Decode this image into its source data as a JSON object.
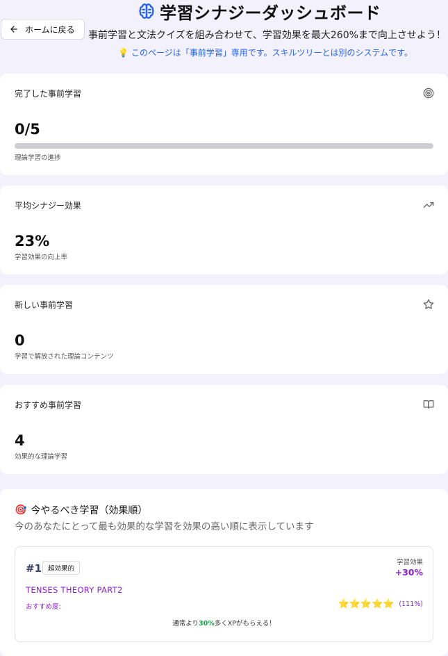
{
  "header": {
    "back_label": "ホームに戻る",
    "title": "学習シナジーダッシュボード",
    "subtitle": "事前学習と文法クイズを組み合わせて、学習効果を最大260%まで向上させよう！",
    "tip_icon": "💡",
    "tip": "このページは「事前学習」専用です。スキルツリーとは別のシステムです。"
  },
  "stats": [
    {
      "title": "完了した事前学習",
      "value": "0/5",
      "caption": "理論学習の進捗",
      "icon": "target-icon",
      "progress": 0
    },
    {
      "title": "平均シナジー効果",
      "value": "23%",
      "caption": "学習効果の向上率",
      "icon": "trending-up-icon"
    },
    {
      "title": "新しい事前学習",
      "value": "0",
      "caption": "学習で解放された理論コンテンツ",
      "icon": "star-icon"
    },
    {
      "title": "おすすめ事前学習",
      "value": "4",
      "caption": "効果的な理論学習",
      "icon": "book-open-icon"
    }
  ],
  "recommend": {
    "icon": "🎯",
    "title": "今やるべき学習（効果順）",
    "description": "今のあなたにとって最も効果的な学習を効果の高い順に表示しています",
    "items": [
      {
        "rank": "#1",
        "badge": "超効果的",
        "effect_label": "学習効果",
        "effect_value": "+30%",
        "name": "TENSES THEORY PART2",
        "recommend_label": "おすすめ度:",
        "stars": "⭐⭐⭐⭐⭐",
        "star_pct": "(111%)",
        "xp_prefix": "通常より",
        "xp_highlight": "30%",
        "xp_suffix": "多くXPがもらえる！"
      }
    ]
  },
  "colors": {
    "accent": "#8b1fd0",
    "link": "#2563eb",
    "positive": "#16a34a",
    "background": "#f3f1fb"
  }
}
